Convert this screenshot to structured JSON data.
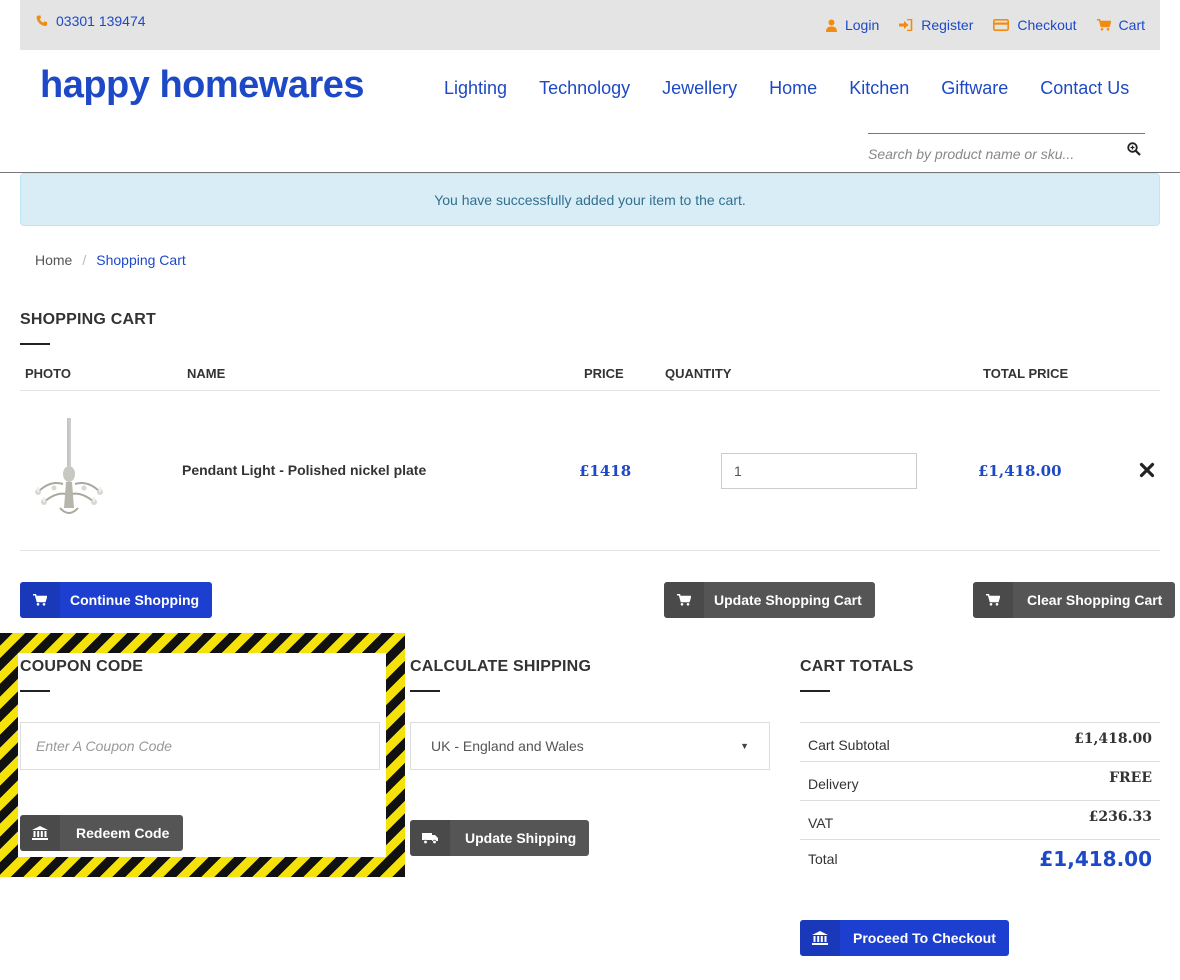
{
  "topbar": {
    "phone": "03301 139474",
    "links": {
      "login": "Login",
      "register": "Register",
      "checkout": "Checkout",
      "cart": "Cart"
    }
  },
  "header": {
    "logo": "happy homewares",
    "nav": [
      "Lighting",
      "Technology",
      "Jewellery",
      "Home",
      "Kitchen",
      "Giftware",
      "Contact Us"
    ],
    "search_placeholder": "Search by product name or sku..."
  },
  "alert": {
    "message": "You have successfully added your item to the cart."
  },
  "breadcrumb": {
    "home": "Home",
    "separator": "/",
    "current": "Shopping Cart"
  },
  "cart": {
    "title": "SHOPPING CART",
    "columns": {
      "photo": "PHOTO",
      "name": "NAME",
      "price": "PRICE",
      "quantity": "QUANTITY",
      "total": "TOTAL PRICE"
    },
    "items": [
      {
        "name": "Pendant Light - Polished nickel plate",
        "price": "£1418",
        "quantity": "1",
        "total": "£1,418.00"
      }
    ]
  },
  "buttons": {
    "continue": "Continue Shopping",
    "update_cart": "Update Shopping Cart",
    "clear_cart": "Clear Shopping Cart",
    "redeem": "Redeem Code",
    "update_shipping": "Update Shipping",
    "checkout": "Proceed To Checkout"
  },
  "coupon": {
    "title": "COUPON CODE",
    "placeholder": "Enter A Coupon Code"
  },
  "shipping": {
    "title": "CALCULATE SHIPPING",
    "selected": "UK - England and Wales"
  },
  "totals": {
    "title": "CART TOTALS",
    "subtotal_label": "Cart Subtotal",
    "subtotal": "£1,418.00",
    "delivery_label": "Delivery",
    "delivery": "FREE",
    "vat_label": "VAT",
    "vat": "£236.33",
    "total_label": "Total",
    "total": "£1,418.00"
  },
  "colors": {
    "brand_blue": "#1d49c6",
    "button_blue": "#1d3fd0",
    "button_gray": "#555555",
    "accent_orange": "#f28c10",
    "alert_bg": "#d9edf7"
  }
}
